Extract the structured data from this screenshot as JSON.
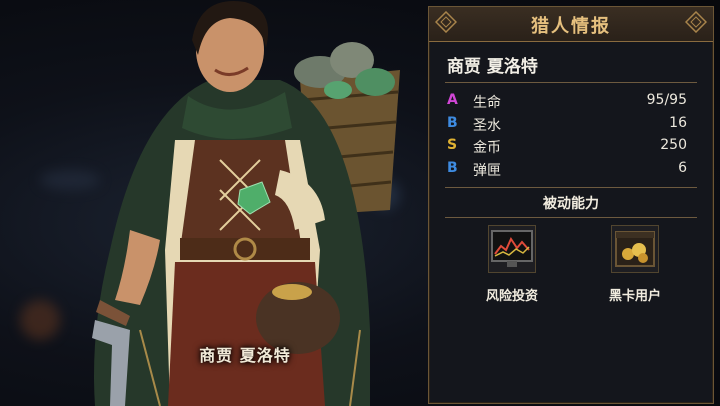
{
  "character": {
    "caption": "商贾 夏洛特"
  },
  "panel": {
    "title": "猎人情报",
    "name": "商贾 夏洛特",
    "stats": [
      {
        "grade": "A",
        "grade_color": "#d146d6",
        "label": "生命",
        "value": "95/95"
      },
      {
        "grade": "B",
        "grade_color": "#3e8be0",
        "label": "圣水",
        "value": "16"
      },
      {
        "grade": "S",
        "grade_color": "#e0b233",
        "label": "金币",
        "value": "250"
      },
      {
        "grade": "B",
        "grade_color": "#3e8be0",
        "label": "弹匣",
        "value": "6"
      }
    ],
    "passive_title": "被动能力",
    "abilities": [
      {
        "label": "风险投资",
        "icon": "stock-chart-icon"
      },
      {
        "label": "黑卡用户",
        "icon": "treasure-chest-icon"
      }
    ]
  },
  "colors": {
    "accent": "#e6c07e",
    "panel_bg": "#14161c",
    "border": "#6b5636"
  }
}
